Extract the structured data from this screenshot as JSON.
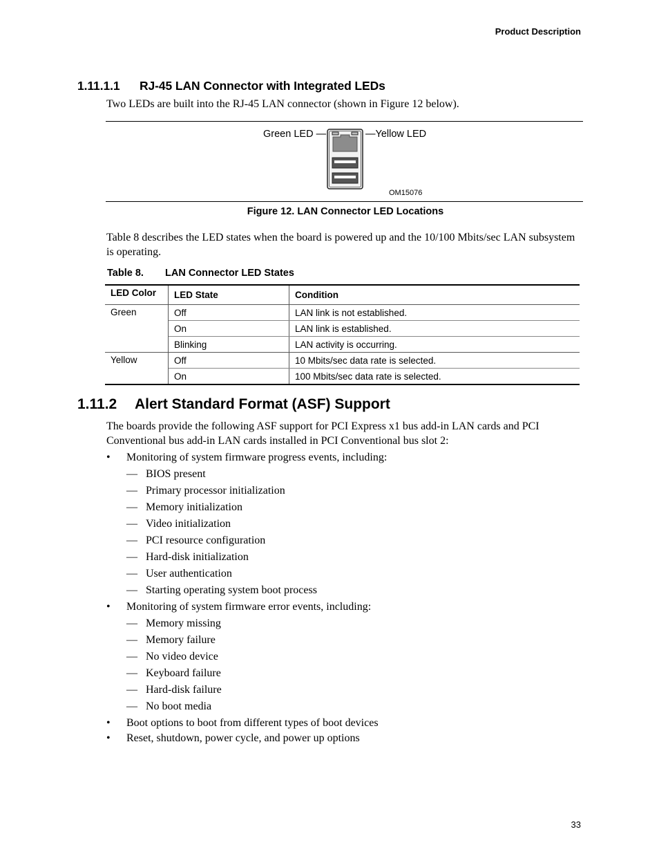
{
  "header": {
    "running_title": "Product Description"
  },
  "section_1_11_1_1": {
    "number": "1.11.1.1",
    "title": "RJ-45 LAN Connector with Integrated LEDs",
    "intro": "Two LEDs are built into the RJ-45 LAN connector (shown in Figure 12 below)."
  },
  "figure": {
    "label_green": "Green LED",
    "label_yellow": "Yellow LED",
    "code": "OM15076",
    "caption": "Figure 12.  LAN Connector LED Locations",
    "icon": "rj45-usb-connector-stack-icon"
  },
  "table_intro": "Table 8 describes the LED states when the board is powered up and the 10/100 Mbits/sec LAN subsystem is operating.",
  "table": {
    "number": "Table 8.",
    "title": "LAN Connector LED States",
    "headers": [
      "LED Color",
      "LED State",
      "Condition"
    ],
    "groups": [
      {
        "color": "Green",
        "rows": [
          {
            "state": "Off",
            "condition": "LAN link is not established."
          },
          {
            "state": "On",
            "condition": "LAN link is established."
          },
          {
            "state": "Blinking",
            "condition": "LAN activity is occurring."
          }
        ]
      },
      {
        "color": "Yellow",
        "rows": [
          {
            "state": "Off",
            "condition": "10 Mbits/sec data rate is selected."
          },
          {
            "state": "On",
            "condition": "100 Mbits/sec data rate is selected."
          }
        ]
      }
    ]
  },
  "section_1_11_2": {
    "number": "1.11.2",
    "title": "Alert Standard Format (ASF) Support",
    "intro": "The boards provide the following ASF support for PCI Express x1 bus add-in LAN cards and PCI Conventional bus add-in LAN cards installed in PCI Conventional bus slot 2:",
    "bullets": [
      {
        "text": "Monitoring of system firmware progress events, including:",
        "sub": [
          "BIOS present",
          "Primary processor initialization",
          "Memory initialization",
          "Video initialization",
          "PCI resource configuration",
          "Hard-disk initialization",
          "User authentication",
          "Starting operating system boot process"
        ]
      },
      {
        "text": "Monitoring of system firmware error events, including:",
        "sub": [
          "Memory missing",
          "Memory failure",
          "No video device",
          "Keyboard failure",
          "Hard-disk failure",
          "No boot media"
        ]
      },
      {
        "text": "Boot options to boot from different types of boot devices",
        "sub": []
      },
      {
        "text": "Reset, shutdown, power cycle, and power up options",
        "sub": []
      }
    ]
  },
  "footer": {
    "page_number": "33"
  }
}
